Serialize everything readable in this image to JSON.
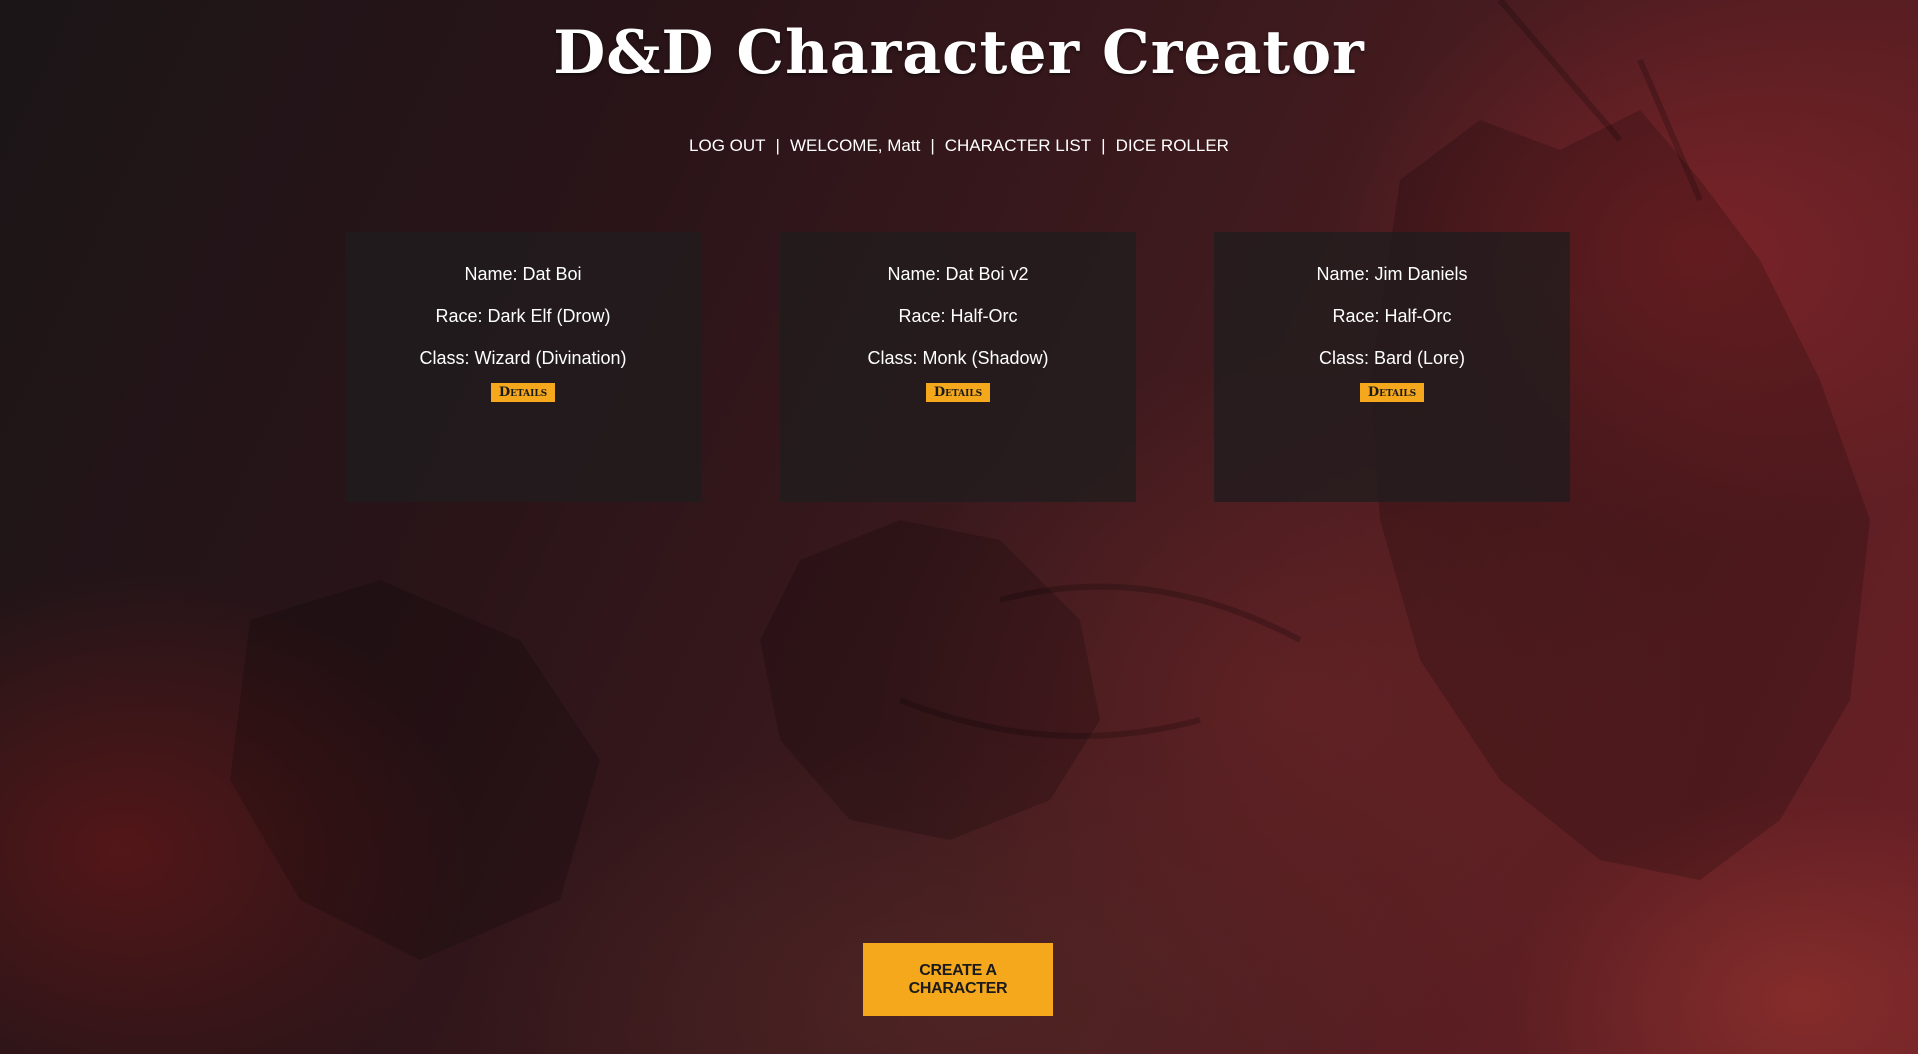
{
  "header": {
    "title": "D&D Character Creator"
  },
  "nav": {
    "logout": "LOG OUT",
    "welcome": "WELCOME, Matt",
    "character_list": "CHARACTER LIST",
    "dice_roller": "DICE ROLLER",
    "separator": "|"
  },
  "characters": [
    {
      "name": "Name: Dat Boi",
      "race": "Race: Dark Elf (Drow)",
      "class": "Class: Wizard (Divination)",
      "details_label": "Details"
    },
    {
      "name": "Name: Dat Boi v2",
      "race": "Race: Half-Orc",
      "class": "Class: Monk (Shadow)",
      "details_label": "Details"
    },
    {
      "name": "Name: Jim Daniels",
      "race": "Race: Half-Orc",
      "class": "Class: Bard (Lore)",
      "details_label": "Details"
    }
  ],
  "actions": {
    "create_label": "Create a Character"
  },
  "colors": {
    "accent": "#f5a81c",
    "card_bg": "#201c1e",
    "background": "#3e1a1e"
  }
}
